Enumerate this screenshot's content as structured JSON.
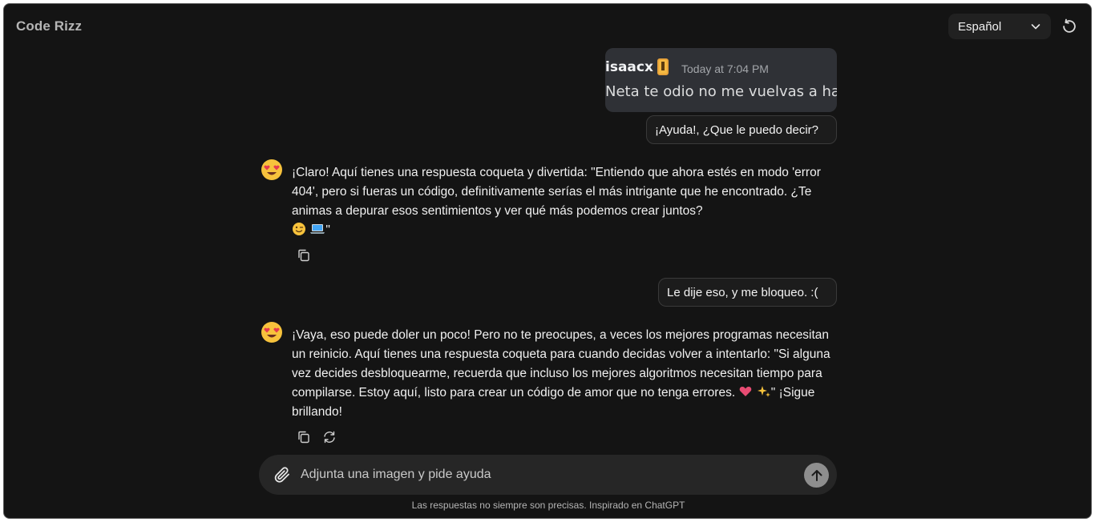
{
  "app": {
    "title": "Code Rizz"
  },
  "header": {
    "language": "Español"
  },
  "attachment": {
    "username": "isaacx",
    "timestamp": "Today at 7:04 PM",
    "message": "Neta te odio no me vuelvas a hal"
  },
  "messages": [
    {
      "role": "user",
      "text": "¡Ayuda!, ¿Que le puedo decir?"
    },
    {
      "role": "assistant",
      "text": "¡Claro! Aquí tienes una respuesta coqueta y divertida: \"Entiendo que ahora estés en modo 'error 404', pero si fueras un código, definitivamente serías el más intrigante que he encontrado. ¿Te animas a depurar esos sentimientos y ver qué más podemos crear juntos?",
      "text_tail": "\""
    },
    {
      "role": "user",
      "text": "Le dije eso, y me bloqueo. :("
    },
    {
      "role": "assistant",
      "text": "¡Vaya, eso puede doler un poco! Pero no te preocupes, a veces los mejores programas necesitan un reinicio. Aquí tienes una respuesta coqueta para cuando decidas volver a intentarlo: \"Si alguna vez decides desbloquearme, recuerda que incluso los mejores algoritmos necesitan tiempo para compilarse. Estoy aquí, listo para crear un código de amor que no tenga errores.",
      "text_tail": "\" ¡Sigue brillando!"
    }
  ],
  "composer": {
    "placeholder": "Adjunta una imagen y pide ayuda"
  },
  "footer": {
    "disclaimer": "Las respuestas no siempre son precisas. Inspirado en ChatGPT"
  },
  "icons": {
    "avatar": "heart-eyes-emoji-icon",
    "language_dropdown": "chevron-down-icon",
    "reset": "refresh-ccw-icon",
    "copy": "copy-icon",
    "regenerate": "regenerate-icon",
    "attach": "paperclip-icon",
    "send": "arrow-up-icon"
  },
  "colors": {
    "background": "#141414",
    "bubble": "#1c1c1c",
    "composer": "#262626"
  }
}
